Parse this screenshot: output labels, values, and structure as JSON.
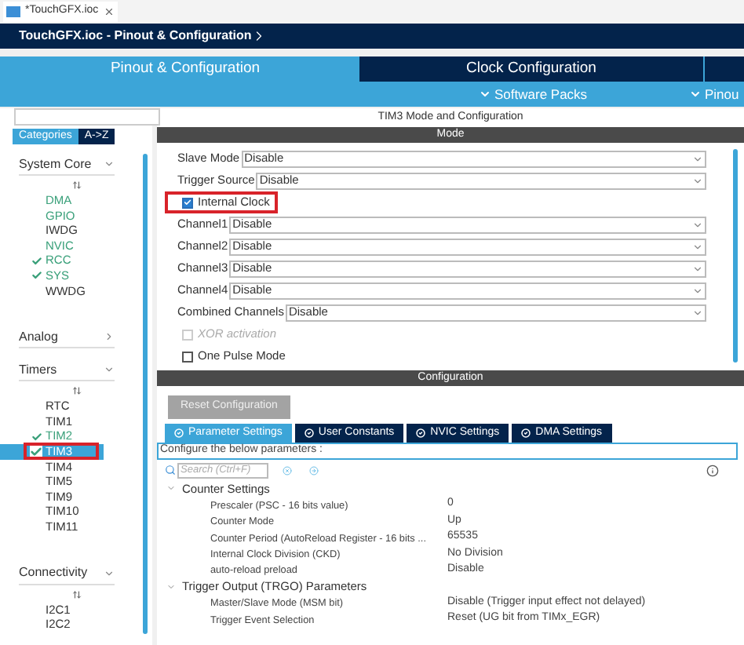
{
  "editor_tab": {
    "title": "*TouchGFX.ioc"
  },
  "breadcrumb": "TouchGFX.ioc - Pinout & Configuration",
  "main_tabs": [
    {
      "label": "Pinout & Configuration",
      "selected": true
    },
    {
      "label": "Clock Configuration",
      "selected": false
    }
  ],
  "sub_menus": [
    "Software Packs",
    "Pinou"
  ],
  "sidebar": {
    "view_tabs": [
      {
        "label": "Categories",
        "selected": true
      },
      {
        "label": "A->Z",
        "selected": false
      }
    ],
    "sections": [
      {
        "title": "System Core",
        "expanded": true,
        "items": [
          {
            "label": "DMA",
            "configured": true,
            "checked": false,
            "selected": false,
            "highlighted": false
          },
          {
            "label": "GPIO",
            "configured": true,
            "checked": false,
            "selected": false,
            "highlighted": false
          },
          {
            "label": "IWDG",
            "configured": false,
            "checked": false,
            "selected": false,
            "highlighted": false
          },
          {
            "label": "NVIC",
            "configured": true,
            "checked": false,
            "selected": false,
            "highlighted": false
          },
          {
            "label": "RCC",
            "configured": true,
            "checked": true,
            "selected": false,
            "highlighted": false
          },
          {
            "label": "SYS",
            "configured": true,
            "checked": true,
            "selected": false,
            "highlighted": false
          },
          {
            "label": "WWDG",
            "configured": false,
            "checked": false,
            "selected": false,
            "highlighted": false
          }
        ]
      },
      {
        "title": "Analog",
        "expanded": false
      },
      {
        "title": "Timers",
        "expanded": true,
        "items": [
          {
            "label": "RTC",
            "configured": false,
            "checked": false,
            "selected": false,
            "highlighted": false
          },
          {
            "label": "TIM1",
            "configured": false,
            "checked": false,
            "selected": false,
            "highlighted": false
          },
          {
            "label": "TIM2",
            "configured": true,
            "checked": true,
            "selected": false,
            "highlighted": false
          },
          {
            "label": "TIM3",
            "configured": true,
            "checked": true,
            "selected": true,
            "highlighted": true
          },
          {
            "label": "TIM4",
            "configured": false,
            "checked": false,
            "selected": false,
            "highlighted": false
          },
          {
            "label": "TIM5",
            "configured": false,
            "checked": false,
            "selected": false,
            "highlighted": false
          },
          {
            "label": "TIM9",
            "configured": false,
            "checked": false,
            "selected": false,
            "highlighted": false
          },
          {
            "label": "TIM10",
            "configured": false,
            "checked": false,
            "selected": false,
            "highlighted": false
          },
          {
            "label": "TIM11",
            "configured": false,
            "checked": false,
            "selected": false,
            "highlighted": false
          }
        ]
      },
      {
        "title": "Connectivity",
        "expanded": true,
        "items": [
          {
            "label": "I2C1",
            "configured": false,
            "checked": false,
            "selected": false,
            "highlighted": false
          },
          {
            "label": "I2C2",
            "configured": false,
            "checked": false,
            "selected": false,
            "highlighted": false
          }
        ]
      }
    ]
  },
  "mode_panel": {
    "title": "TIM3 Mode and Configuration",
    "header": "Mode",
    "fields": [
      {
        "kind": "select",
        "label": "Slave Mode",
        "value": "Disable"
      },
      {
        "kind": "select",
        "label": "Trigger Source",
        "value": "Disable"
      },
      {
        "kind": "checkbox",
        "label": "Internal Clock",
        "checked": true,
        "disabled": false,
        "highlighted": true
      },
      {
        "kind": "select",
        "label": "Channel1",
        "value": "Disable"
      },
      {
        "kind": "select",
        "label": "Channel2",
        "value": "Disable"
      },
      {
        "kind": "select",
        "label": "Channel3",
        "value": "Disable"
      },
      {
        "kind": "select",
        "label": "Channel4",
        "value": "Disable"
      },
      {
        "kind": "select",
        "label": "Combined Channels",
        "value": "Disable"
      },
      {
        "kind": "checkbox",
        "label": "XOR activation",
        "checked": false,
        "disabled": true,
        "highlighted": false
      },
      {
        "kind": "checkbox",
        "label": "One Pulse Mode",
        "checked": false,
        "disabled": false,
        "highlighted": false
      }
    ]
  },
  "config_panel": {
    "header": "Configuration",
    "reset_button": {
      "label": "Reset Configuration",
      "disabled": true
    },
    "tabs": [
      {
        "label": "Parameter Settings",
        "selected": true
      },
      {
        "label": "User Constants",
        "selected": false
      },
      {
        "label": "NVIC Settings",
        "selected": false
      },
      {
        "label": "DMA Settings",
        "selected": false
      }
    ],
    "hint": "Configure the below parameters :",
    "search": {
      "placeholder": "Search (Ctrl+F)"
    },
    "groups": [
      {
        "title": "Counter Settings",
        "expanded": true,
        "params": [
          {
            "name": "Prescaler (PSC - 16 bits value)",
            "value": "0"
          },
          {
            "name": "Counter Mode",
            "value": "Up"
          },
          {
            "name": "Counter Period (AutoReload Register - 16 bits ...",
            "value": "65535"
          },
          {
            "name": "Internal Clock Division (CKD)",
            "value": "No Division"
          },
          {
            "name": "auto-reload preload",
            "value": "Disable"
          }
        ]
      },
      {
        "title": "Trigger Output (TRGO) Parameters",
        "expanded": true,
        "params": [
          {
            "name": "Master/Slave Mode (MSM bit)",
            "value": "Disable (Trigger input effect not delayed)"
          },
          {
            "name": "Trigger Event Selection",
            "value": "Reset (UG bit from TIMx_EGR)"
          }
        ]
      }
    ]
  }
}
